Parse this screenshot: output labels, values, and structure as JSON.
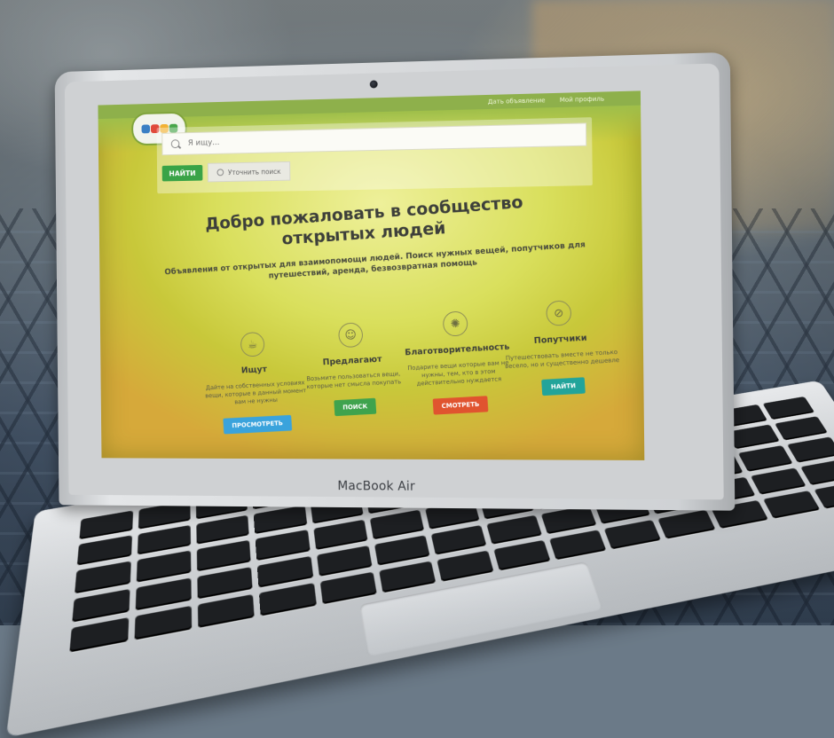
{
  "topbar": {
    "links": [
      "Дать объявление",
      "Мой профиль"
    ]
  },
  "logo": {
    "colors": [
      "#3a7fc4",
      "#e04a3b",
      "#f2b233",
      "#48a54a"
    ]
  },
  "search": {
    "placeholder": "Я ищу...",
    "find_label": "НАЙТИ",
    "refine_label": "Уточнить поиск"
  },
  "hero": {
    "title": "Добро пожаловать в сообщество открытых людей",
    "subtitle": "Объявления от открытых для взаимопомощи людей. Поиск нужных вещей, попутчиков для путешествий, аренда, безвозвратная помощь"
  },
  "features": [
    {
      "icon": "cup-icon",
      "glyph": "☕",
      "title": "Ищут",
      "desc": "Дайте на собственных условиях вещи, которые в данный момент вам не нужны",
      "button": "ПРОСМОТРЕТЬ",
      "color": "#3aa3dc"
    },
    {
      "icon": "smile-icon",
      "glyph": "☺",
      "title": "Предлагают",
      "desc": "Возьмите пользоваться вещи, которые нет смысла покупать",
      "button": "ПОИСК",
      "color": "#3fa34d"
    },
    {
      "icon": "sun-icon",
      "glyph": "✺",
      "title": "Благотворительность",
      "desc": "Подарите вещи которые вам не нужны, тем, кто в этом действительно нуждается",
      "button": "СМОТРЕТЬ",
      "color": "#e0542f"
    },
    {
      "icon": "compass-icon",
      "glyph": "⊘",
      "title": "Попутчики",
      "desc": "Путешествовать вместе не только весело, но и существенно дешевле",
      "button": "НАЙТИ",
      "color": "#22a49a"
    }
  ],
  "device": {
    "brand": "MacBook Air"
  }
}
